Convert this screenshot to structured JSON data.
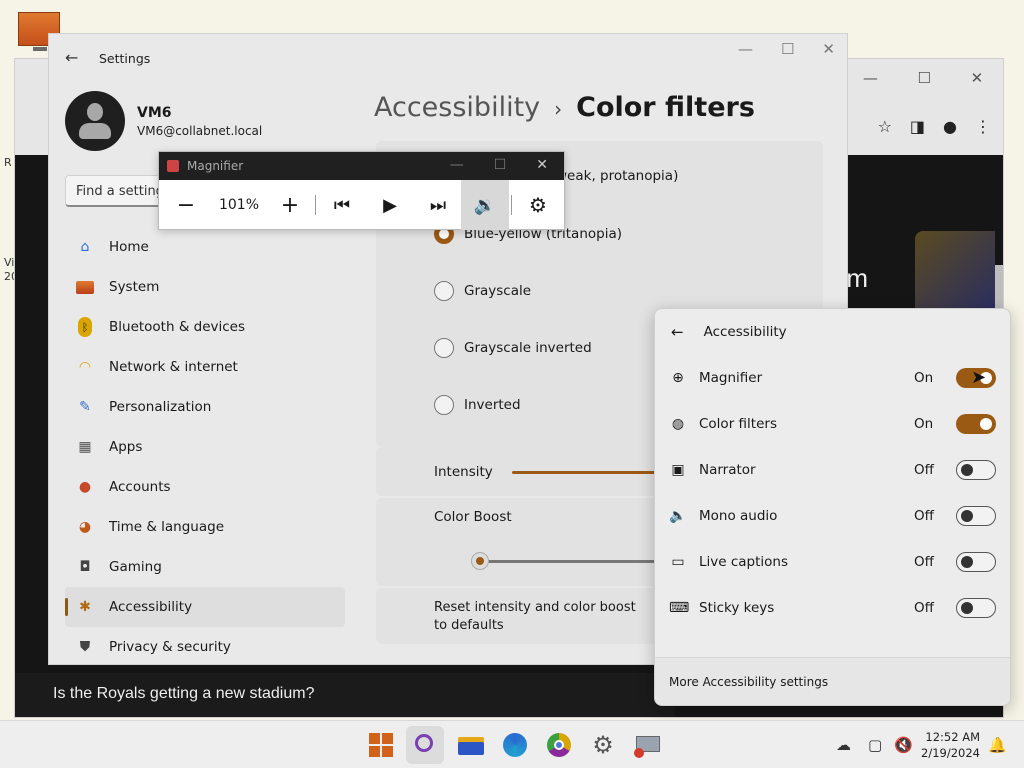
{
  "desktop": {
    "side_text_1": "R",
    "side_text_2": "Vi",
    "side_text_3": "20"
  },
  "browser": {
    "news_headline": "Is the Royals getting a new stadium?",
    "partial_text": "m"
  },
  "settings": {
    "title": "Settings",
    "user": {
      "name": "VM6",
      "email": "VM6@collabnet.local"
    },
    "search_placeholder": "Find a setting",
    "nav": [
      {
        "label": "Home",
        "icon": "home-icon"
      },
      {
        "label": "System",
        "icon": "system-icon"
      },
      {
        "label": "Bluetooth & devices",
        "icon": "bluetooth-icon"
      },
      {
        "label": "Network & internet",
        "icon": "wifi-icon"
      },
      {
        "label": "Personalization",
        "icon": "brush-icon"
      },
      {
        "label": "Apps",
        "icon": "apps-icon"
      },
      {
        "label": "Accounts",
        "icon": "accounts-icon"
      },
      {
        "label": "Time & language",
        "icon": "clock-globe-icon"
      },
      {
        "label": "Gaming",
        "icon": "gamepad-icon"
      },
      {
        "label": "Accessibility",
        "icon": "accessibility-icon",
        "active": true
      },
      {
        "label": "Privacy & security",
        "icon": "shield-icon"
      }
    ],
    "breadcrumb": {
      "parent": "Accessibility",
      "separator": "›",
      "current": "Color filters"
    },
    "filters": [
      {
        "label": "weak, protanopia)",
        "selected": false,
        "partial": true
      },
      {
        "label": "Blue-yellow (tritanopia)",
        "selected": true
      },
      {
        "label": "Grayscale",
        "selected": false
      },
      {
        "label": "Grayscale inverted",
        "selected": false
      },
      {
        "label": "Inverted",
        "selected": false
      }
    ],
    "intensity_label": "Intensity",
    "color_boost_label": "Color Boost",
    "reset_label_line1": "Reset intensity and color boost",
    "reset_label_line2": "to defaults"
  },
  "magnifier": {
    "title": "Magnifier",
    "zoom": "101%"
  },
  "quick_panel": {
    "title": "Accessibility",
    "items": [
      {
        "label": "Magnifier",
        "state": "On",
        "on": true,
        "icon": "magnifier-icon"
      },
      {
        "label": "Color filters",
        "state": "On",
        "on": true,
        "icon": "palette-icon"
      },
      {
        "label": "Narrator",
        "state": "Off",
        "on": false,
        "icon": "narrator-icon"
      },
      {
        "label": "Mono audio",
        "state": "Off",
        "on": false,
        "icon": "speaker-icon"
      },
      {
        "label": "Live captions",
        "state": "Off",
        "on": false,
        "icon": "captions-icon"
      },
      {
        "label": "Sticky keys",
        "state": "Off",
        "on": false,
        "icon": "keyboard-icon"
      }
    ],
    "footer": "More Accessibility settings"
  },
  "taskbar": {
    "time": "12:52 AM",
    "date": "2/19/2024"
  },
  "colors": {
    "accent": "#9b5a14"
  }
}
